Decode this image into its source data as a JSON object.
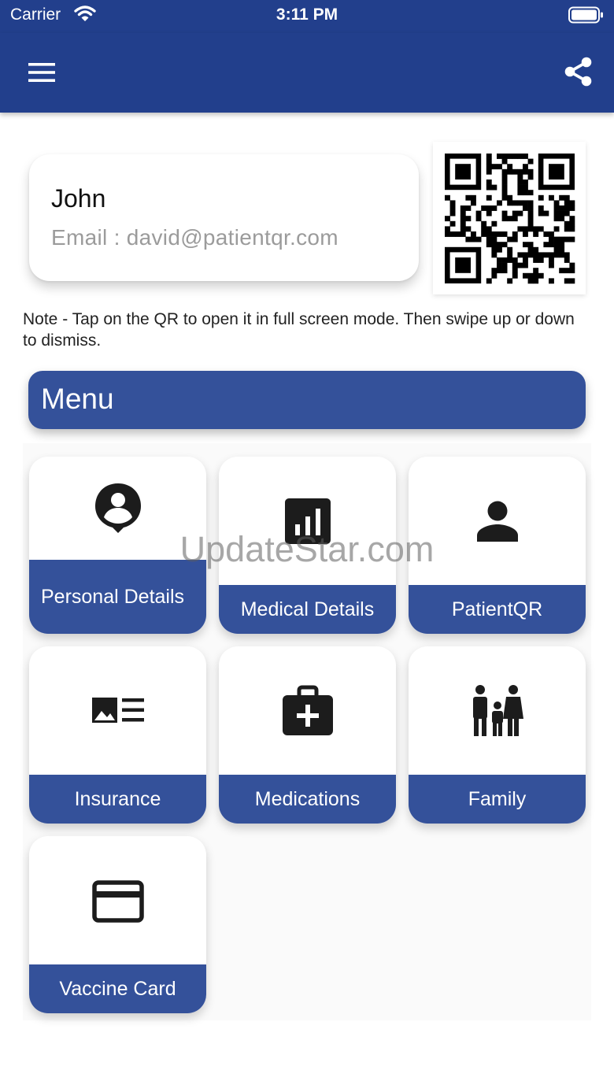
{
  "status_bar": {
    "carrier": "Carrier",
    "time": "3:11 PM"
  },
  "colors": {
    "header": "#223f8c",
    "accent": "#34519a"
  },
  "app_bar": {
    "left_icon": "hamburger-menu-icon",
    "right_icon": "share-icon"
  },
  "profile": {
    "name": "John",
    "email": "Email : david@patientqr.com"
  },
  "note": "Note - Tap on the QR to open it in full screen mode. Then swipe up or down to dismiss.",
  "menu": {
    "title": "Menu",
    "items": [
      {
        "label": "Personal Details",
        "icon": "person-pin-icon"
      },
      {
        "label": "Medical Details",
        "icon": "chart-icon"
      },
      {
        "label": "PatientQR",
        "icon": "person-icon"
      },
      {
        "label": "Insurance",
        "icon": "id-card-icon"
      },
      {
        "label": "Medications",
        "icon": "medical-bag-icon"
      },
      {
        "label": "Family",
        "icon": "family-icon"
      },
      {
        "label": "Vaccine Card",
        "icon": "credit-card-icon"
      }
    ]
  },
  "watermark": "UpdateStar.com"
}
